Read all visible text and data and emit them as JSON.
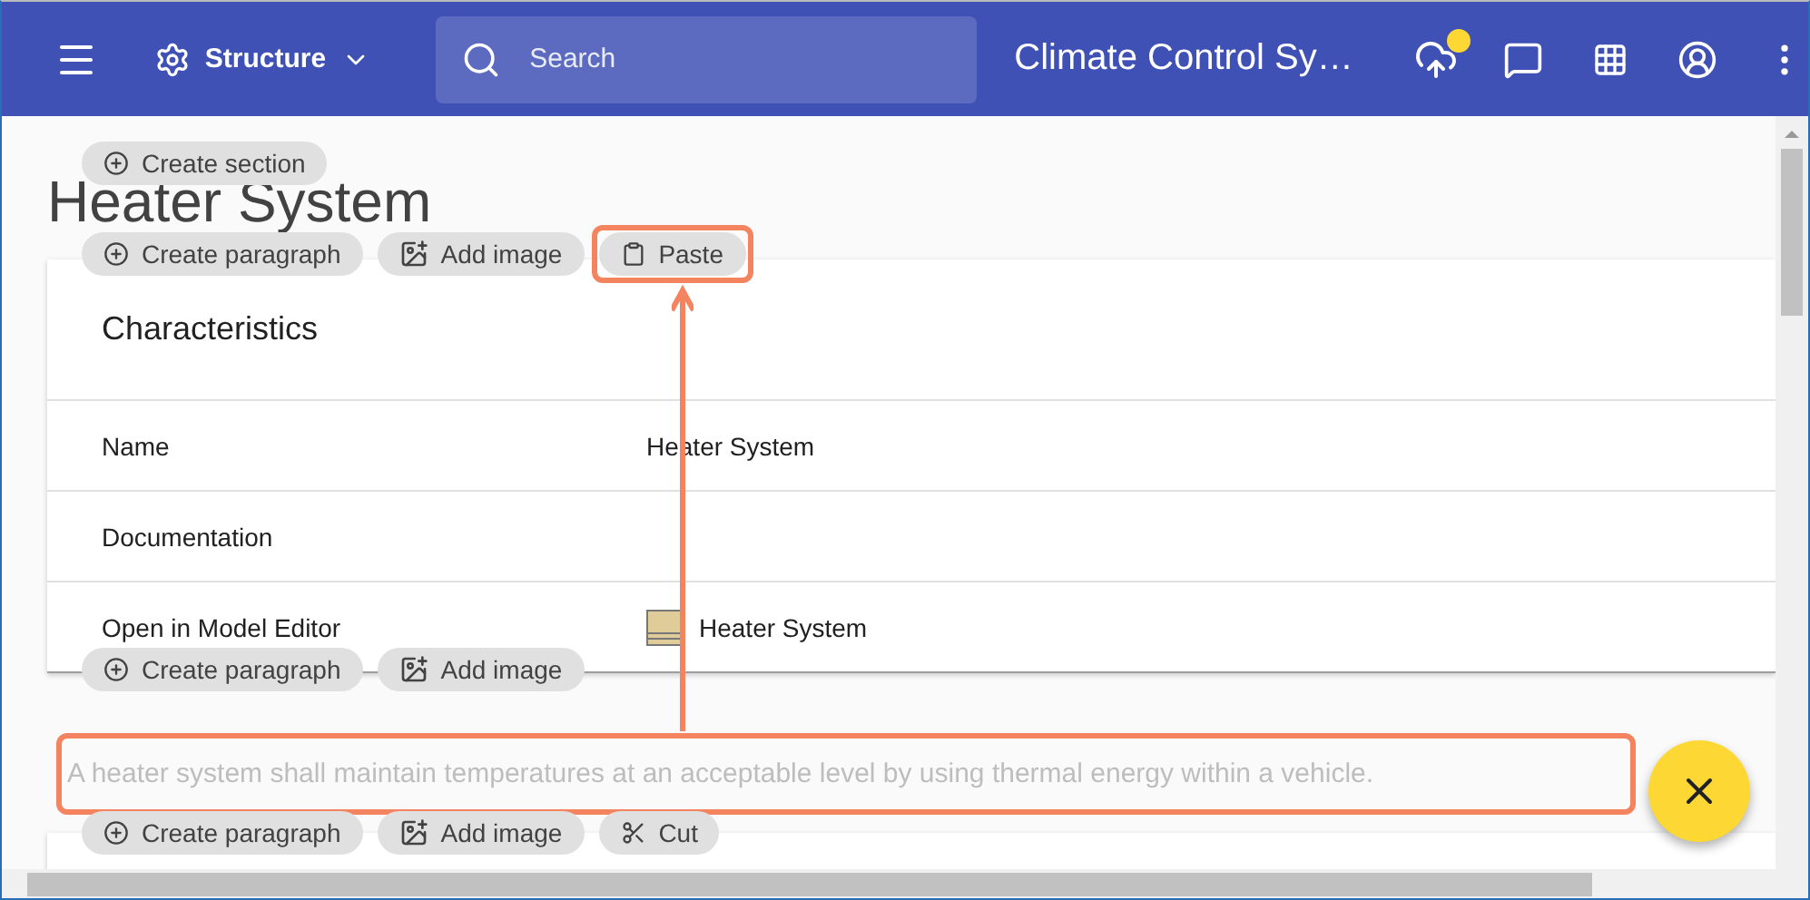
{
  "app_bar": {
    "section_menu": "Structure",
    "search": {
      "placeholder": "Search"
    },
    "project_title": "Climate Control Sy…",
    "upload_pending": true
  },
  "page": {
    "create_section": "Create section",
    "title": "Heater System",
    "title_actions": [
      {
        "kind": "create",
        "label": "Create paragraph",
        "highlighted": false
      },
      {
        "kind": "image",
        "label": "Add image",
        "highlighted": false
      },
      {
        "kind": "paste",
        "label": "Paste",
        "highlighted": true
      }
    ],
    "card": {
      "title": "Characteristics",
      "rows": [
        {
          "kind": "text",
          "label": "Name",
          "value": "Heater System"
        },
        {
          "kind": "text",
          "label": "Documentation"
        },
        {
          "kind": "model-link",
          "label": "Open in Model Editor",
          "value": "Heater System"
        }
      ]
    },
    "card_actions": [
      {
        "kind": "create",
        "label": "Create paragraph",
        "highlighted": false
      },
      {
        "kind": "image",
        "label": "Add image",
        "highlighted": false
      }
    ],
    "paragraph": {
      "text": "A heater system shall maintain temperatures at an acceptable level by using thermal energy within a vehicle.",
      "highlighted": true
    },
    "paragraph_actions": [
      {
        "kind": "create",
        "label": "Create paragraph",
        "highlighted": false
      },
      {
        "kind": "image",
        "label": "Add image",
        "highlighted": false
      },
      {
        "kind": "cut",
        "label": "Cut",
        "highlighted": false
      }
    ]
  }
}
